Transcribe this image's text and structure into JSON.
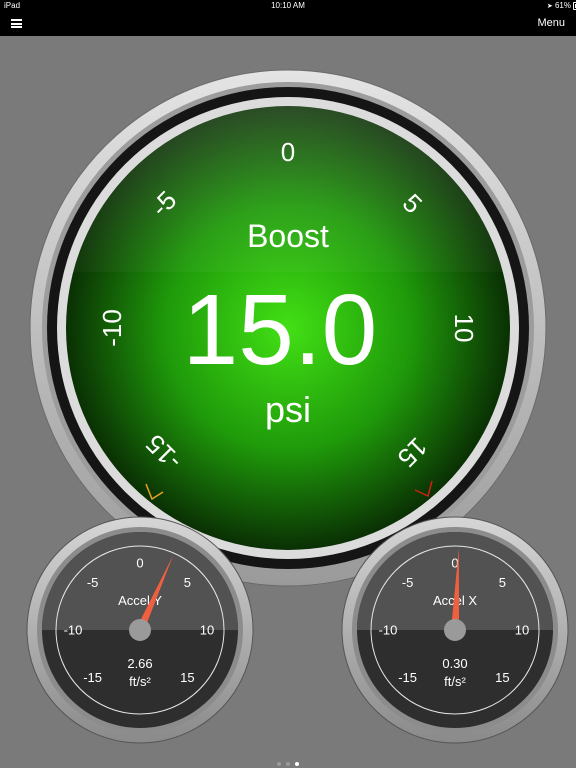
{
  "statusbar": {
    "device": "iPad",
    "time": "10:10 AM",
    "battery_text": "61%",
    "battery_level": 0.61
  },
  "navbar": {
    "menu_label": "Menu",
    "hamburger_icon": "hamburger-menu-icon"
  },
  "boost_gauge": {
    "title": "Boost",
    "value_text": "15.0",
    "unit": "psi",
    "value": 15.0,
    "scale_min": -15,
    "scale_max": 15,
    "ticks": [
      "-15",
      "-10",
      "-5",
      "0",
      "5",
      "10",
      "15"
    ],
    "min_marker_color": "#e8a020",
    "max_marker_color": "#d02010",
    "face_color": "#2fc00e"
  },
  "accel_y_gauge": {
    "title": "Accel Y",
    "value_text": "2.66",
    "unit": "ft/s²",
    "value": 2.66,
    "ticks": [
      "-15",
      "-10",
      "-5",
      "0",
      "5",
      "10",
      "15"
    ],
    "needle_color": "#f06040"
  },
  "accel_x_gauge": {
    "title": "Accel X",
    "value_text": "0.30",
    "unit": "ft/s²",
    "value": 0.3,
    "ticks": [
      "-15",
      "-10",
      "-5",
      "0",
      "5",
      "10",
      "15"
    ],
    "needle_color": "#f06040"
  },
  "page_indicator": {
    "count": 3,
    "active": 2
  }
}
